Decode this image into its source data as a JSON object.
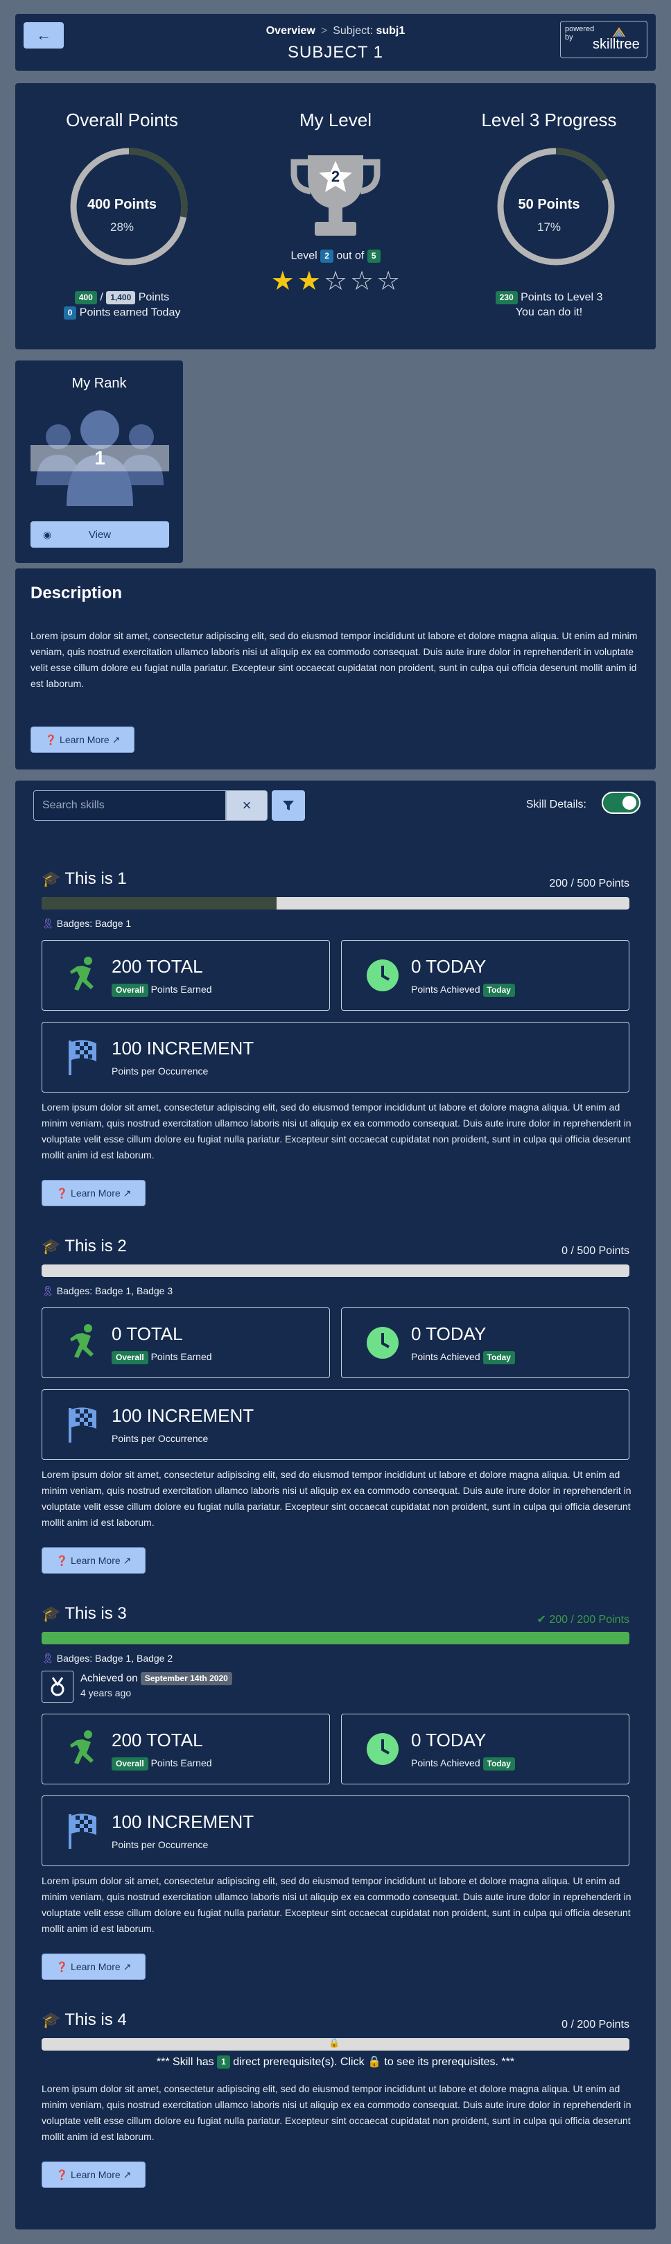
{
  "header": {
    "back_icon": "←",
    "crumb_overview": "Overview",
    "crumb_sep": ">",
    "crumb_subject_label": "Subject:",
    "crumb_subject_value": "subj1",
    "title": "SUBJECT 1",
    "powered_by": "powered by",
    "brand": "skilltree"
  },
  "overview": {
    "overall": {
      "title": "Overall Points",
      "points": "400 Points",
      "percent": "28%",
      "fraction": 0.28,
      "earned": "400",
      "sep": "/",
      "total": "1,400",
      "points_label": "Points",
      "today": "0",
      "today_label": "Points earned Today"
    },
    "level": {
      "title": "My Level",
      "level": "2",
      "level_label": "Level",
      "out_of_label": "out of",
      "max": "5",
      "stars_filled": 2,
      "stars_total": 5
    },
    "progress": {
      "title": "Level 3 Progress",
      "points": "50 Points",
      "percent": "17%",
      "fraction": 0.17,
      "to_go": "230",
      "to_go_label": "Points to Level 3",
      "encourage": "You can do it!"
    }
  },
  "rank": {
    "title": "My Rank",
    "value": "1",
    "view_label": "View"
  },
  "description": {
    "title": "Description",
    "text": "Lorem ipsum dolor sit amet, consectetur adipiscing elit, sed do eiusmod tempor incididunt ut labore et dolore magna aliqua. Ut enim ad minim veniam, quis nostrud exercitation ullamco laboris nisi ut aliquip ex ea commodo consequat. Duis aute irure dolor in reprehenderit in voluptate velit esse cillum dolore eu fugiat nulla pariatur. Excepteur sint occaecat cupidatat non proident, sunt in culpa qui officia deserunt mollit anim id est laborum.",
    "learn_more": "Learn More"
  },
  "skills_panel": {
    "search_placeholder": "Search skills",
    "clear_icon": "×",
    "skill_details_label": "Skill Details:",
    "skill_details_on": true
  },
  "skills": [
    {
      "title": "This is 1",
      "points": "200 / 500 Points",
      "fraction": 0.4,
      "badges": "Badges: Badge 1",
      "total": "200 TOTAL",
      "total_badge": "Overall",
      "total_label": "Points Earned",
      "today": "0 TODAY",
      "today_label": "Points Achieved",
      "today_badge": "Today",
      "increment": "100 INCREMENT",
      "increment_label": "Points per Occurrence",
      "text": "Lorem ipsum dolor sit amet, consectetur adipiscing elit, sed do eiusmod tempor incididunt ut labore et dolore magna aliqua. Ut enim ad minim veniam, quis nostrud exercitation ullamco laboris nisi ut aliquip ex ea commodo consequat. Duis aute irure dolor in reprehenderit in voluptate velit esse cillum dolore eu fugiat nulla pariatur. Excepteur sint occaecat cupidatat non proident, sunt in culpa qui officia deserunt mollit anim id est laborum.",
      "learn_more": "Learn More"
    },
    {
      "title": "This is 2",
      "points": "0 / 500 Points",
      "fraction": 0,
      "badges": "Badges: Badge 1, Badge 3",
      "total": "0 TOTAL",
      "total_badge": "Overall",
      "total_label": "Points Earned",
      "today": "0 TODAY",
      "today_label": "Points Achieved",
      "today_badge": "Today",
      "increment": "100 INCREMENT",
      "increment_label": "Points per Occurrence",
      "text": "Lorem ipsum dolor sit amet, consectetur adipiscing elit, sed do eiusmod tempor incididunt ut labore et dolore magna aliqua. Ut enim ad minim veniam, quis nostrud exercitation ullamco laboris nisi ut aliquip ex ea commodo consequat. Duis aute irure dolor in reprehenderit in voluptate velit esse cillum dolore eu fugiat nulla pariatur. Excepteur sint occaecat cupidatat non proident, sunt in culpa qui officia deserunt mollit anim id est laborum.",
      "learn_more": "Learn More"
    },
    {
      "title": "This is 3",
      "points": "200 / 200 Points",
      "fraction": 1,
      "badges": "Badges: Badge 1, Badge 2",
      "achieved_label": "Achieved on",
      "achieved_date": "September 14th 2020",
      "achieved_ago": "4 years ago",
      "total": "200 TOTAL",
      "total_badge": "Overall",
      "total_label": "Points Earned",
      "today": "0 TODAY",
      "today_label": "Points Achieved",
      "today_badge": "Today",
      "increment": "100 INCREMENT",
      "increment_label": "Points per Occurrence",
      "text": "Lorem ipsum dolor sit amet, consectetur adipiscing elit, sed do eiusmod tempor incididunt ut labore et dolore magna aliqua. Ut enim ad minim veniam, quis nostrud exercitation ullamco laboris nisi ut aliquip ex ea commodo consequat. Duis aute irure dolor in reprehenderit in voluptate velit esse cillum dolore eu fugiat nulla pariatur. Excepteur sint occaecat cupidatat non proident, sunt in culpa qui officia deserunt mollit anim id est laborum.",
      "learn_more": "Learn More"
    },
    {
      "title": "This is 4",
      "points": "0 / 200 Points",
      "fraction": 0,
      "prereq_pre": "*** Skill has",
      "prereq_count": "1",
      "prereq_mid": "direct prerequisite(s). Click",
      "prereq_post": "to see its prerequisites. ***",
      "text": "Lorem ipsum dolor sit amet, consectetur adipiscing elit, sed do eiusmod tempor incididunt ut labore et dolore magna aliqua. Ut enim ad minim veniam, quis nostrud exercitation ullamco laboris nisi ut aliquip ex ea commodo consequat. Duis aute irure dolor in reprehenderit in voluptate velit esse cillum dolore eu fugiat nulla pariatur. Excepteur sint occaecat cupidatat non proident, sunt in culpa qui officia deserunt mollit anim id est laborum.",
      "learn_more": "Learn More"
    }
  ],
  "colors": {
    "page_bg": "#5f6d80",
    "card_bg": "#152a4d",
    "accent_button": "#a7c7f7",
    "progress_dark": "#3b4a3e",
    "progress_complete": "#4caf50",
    "star_gold": "#f3c614",
    "badge_green": "#1e7a52",
    "runner_green": "#4caf50",
    "clock_green": "#6fe08a",
    "flag_blue": "#6f9fe6"
  }
}
